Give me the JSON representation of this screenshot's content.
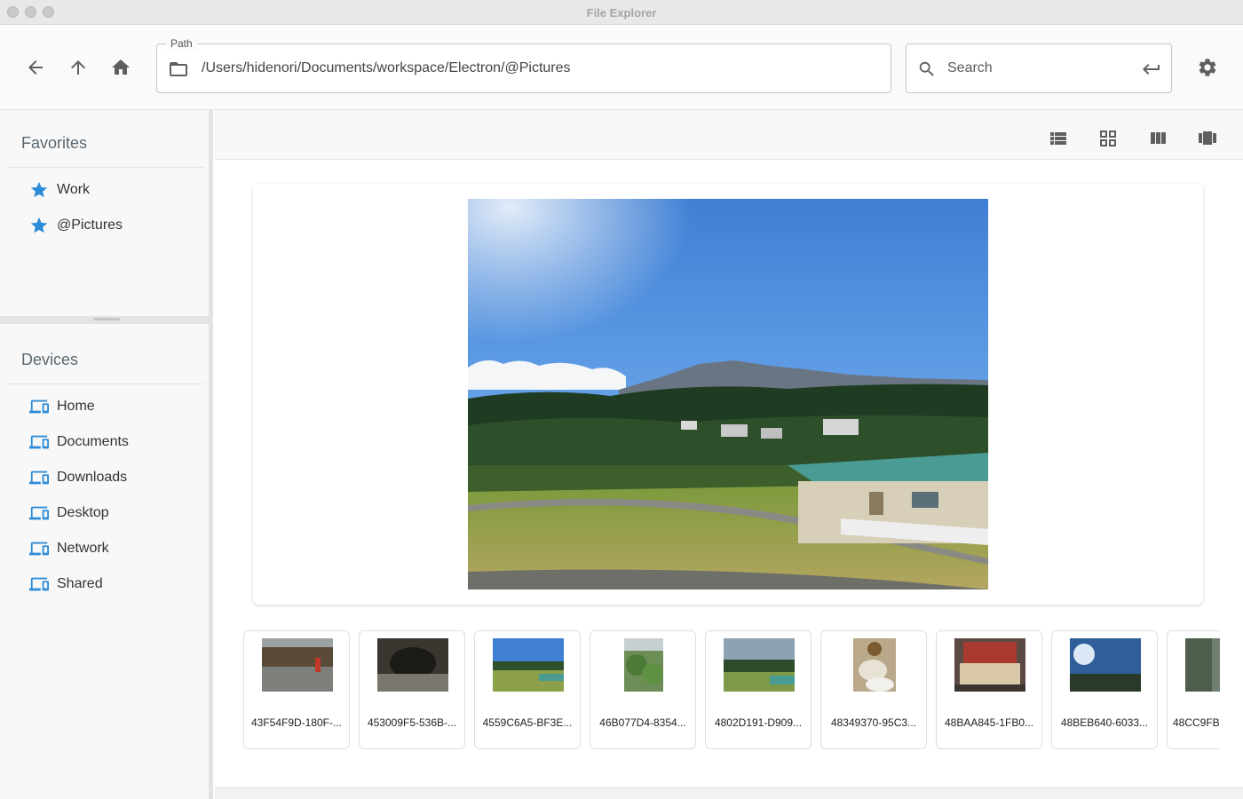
{
  "window": {
    "title": "File Explorer"
  },
  "toolbar": {
    "back_icon": "arrow-left-icon",
    "up_icon": "arrow-up-icon",
    "home_icon": "home-icon",
    "path_label": "Path",
    "path_value": "/Users/hidenori/Documents/workspace/Electron/@Pictures",
    "search_placeholder": "Search",
    "settings_icon": "gear-icon"
  },
  "sidebar": {
    "favorites_title": "Favorites",
    "favorites": [
      {
        "label": "Work",
        "icon": "star-icon"
      },
      {
        "label": "@Pictures",
        "icon": "star-icon"
      }
    ],
    "devices_title": "Devices",
    "devices": [
      {
        "label": "Home",
        "icon": "computer-icon"
      },
      {
        "label": "Documents",
        "icon": "computer-icon"
      },
      {
        "label": "Downloads",
        "icon": "computer-icon"
      },
      {
        "label": "Desktop",
        "icon": "computer-icon"
      },
      {
        "label": "Network",
        "icon": "computer-icon"
      },
      {
        "label": "Shared",
        "icon": "computer-icon"
      }
    ]
  },
  "view_modes": [
    "list-view-icon",
    "grid-view-icon",
    "column-view-icon",
    "gallery-view-icon"
  ],
  "thumbnails": [
    {
      "name": "43F54F9D-180F-..."
    },
    {
      "name": "453009F5-536B-..."
    },
    {
      "name": "4559C6A5-BF3E..."
    },
    {
      "name": "46B077D4-8354..."
    },
    {
      "name": "4802D191-D909..."
    },
    {
      "name": "48349370-95C3..."
    },
    {
      "name": "48BAA845-1FB0..."
    },
    {
      "name": "48BEB640-6033..."
    },
    {
      "name": "48CC9FB"
    }
  ],
  "colors": {
    "accent": "#2e8bd6",
    "icon": "#5f5f5f"
  }
}
